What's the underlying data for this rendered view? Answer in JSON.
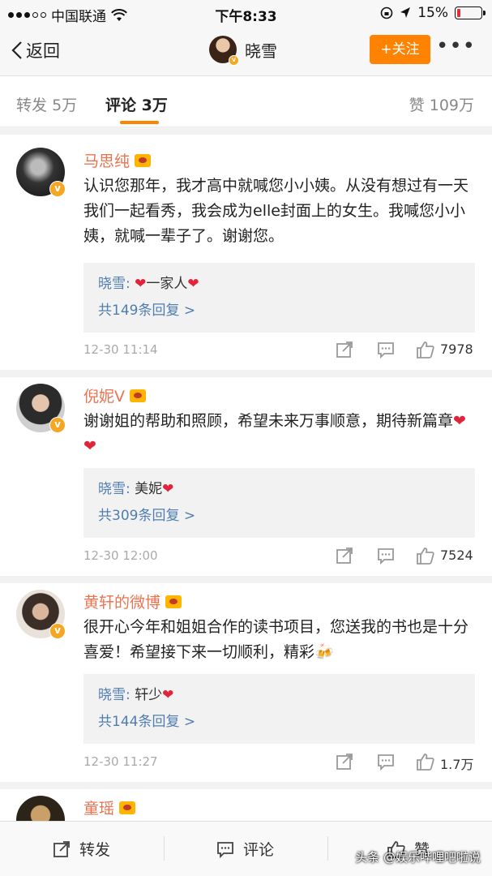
{
  "status_bar": {
    "carrier": "中国联通",
    "time": "下午8:33",
    "battery_percent": "15%",
    "battery_level": 0.15
  },
  "nav": {
    "back_label": "返回",
    "title": "晓雪",
    "follow_label": "+关注",
    "more_label": "•••"
  },
  "tabs": {
    "repost_label": "转发",
    "repost_count": "5万",
    "comment_label": "评论",
    "comment_count": "3万",
    "like_label": "赞",
    "like_count": "109万"
  },
  "comments": [
    {
      "name": "马思纯",
      "text": "认识您那年，我才高中就喊您小小姨。从没有想过有一天我们一起看秀，我会成为elle封面上的女生。我喊您小小姨，就喊一辈子了。谢谢您。",
      "reply_author": "晓雪:",
      "reply_text": "一家人",
      "reply_count": "共149条回复 >",
      "time": "12-30 11:14",
      "likes": "7978"
    },
    {
      "name": "倪妮V",
      "text": "谢谢姐的帮助和照顾，希望未来万事顺意，期待新篇章",
      "reply_author": "晓雪:",
      "reply_text": "美妮",
      "reply_count": "共309条回复 >",
      "time": "12-30 12:00",
      "likes": "7524"
    },
    {
      "name": "黄轩的微博",
      "text": "很开心今年和姐姐合作的读书项目，您送我的书也是十分喜爱！希望接下来一切顺利，精彩",
      "reply_author": "晓雪:",
      "reply_text": "轩少",
      "reply_count": "共144条回复 >",
      "time": "12-30 11:27",
      "likes": "1.7万"
    },
    {
      "name": "童瑶"
    }
  ],
  "bottom_bar": {
    "repost": "转发",
    "comment": "评论",
    "like": "赞"
  },
  "watermark": "头条 @娱乐哔哩吧啦说",
  "colors": {
    "accent_orange": "#ff8200",
    "name_color": "#eb7350",
    "link_blue": "#507daf",
    "heart_red": "#e0243a"
  }
}
